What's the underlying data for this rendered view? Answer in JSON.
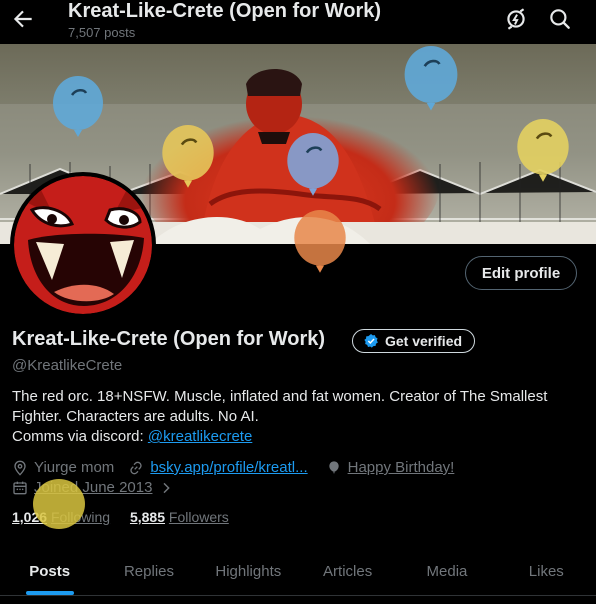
{
  "header": {
    "title": "Kreat-Like-Crete (Open for Work)",
    "post_count": "7,507 posts"
  },
  "profile": {
    "display_name": "Kreat-Like-Crete (Open for Work)",
    "verify_label": "Get verified",
    "handle": "@KreatlikeCrete",
    "edit_label": "Edit profile",
    "bio_line1": "The red orc. 18+NSFW. Muscle, inflated and fat women. Creator of The Smallest Fighter. Characters are adults. No AI.",
    "bio_line2_prefix": "Comms via discord: ",
    "bio_mention": "@kreatlikecrete",
    "location": "Yiurge mom",
    "website": "bsky.app/profile/kreatl...",
    "birthday": "Happy Birthday!",
    "joined": "Joined June 2013",
    "following_count": "1,026",
    "following_label": "Following",
    "followers_count": "5,885",
    "followers_label": "Followers"
  },
  "tabs": [
    "Posts",
    "Replies",
    "Highlights",
    "Articles",
    "Media",
    "Likes"
  ],
  "colors": {
    "accent": "#1d9bf0",
    "background": "#000000",
    "text": "#e7e9ea",
    "muted": "#71767b",
    "banner_red": "#c9301f"
  }
}
